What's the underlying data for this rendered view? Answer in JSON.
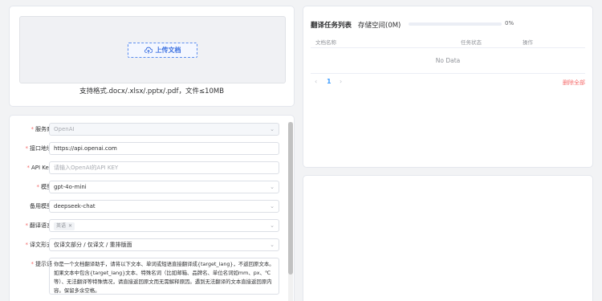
{
  "upload": {
    "button_label": "上传文档",
    "formats_hint": "支持格式.docx/.xlsx/.pptx/.pdf，文件≤10MB"
  },
  "settings": {
    "service": {
      "label": "服务商",
      "required": "*",
      "value": "OpenAI"
    },
    "endpoint": {
      "label": "接口地址",
      "required": "*",
      "value": "https://api.openai.com"
    },
    "api_key": {
      "label": "API Key",
      "required": "*",
      "placeholder": "请输入OpenAI的API KEY"
    },
    "model": {
      "label": "模型",
      "required": "*",
      "value": "gpt-4o-mini"
    },
    "backup_model": {
      "label": "备用模型",
      "value": "deepseek-chat"
    },
    "target_language": {
      "label": "翻译语言",
      "required": "*",
      "tag": "英语"
    },
    "translation_form": {
      "label": "译文形式",
      "required": "*",
      "value": "仅译文部分 / 仅译文 / 重排版面"
    },
    "prompt": {
      "label": "提示语",
      "required": "*",
      "value": "你是一个文档翻译助手，请将以下文本、单词或短语直接翻译成{target_lang}，不返回原文本。如果文本中包含{target_lang}文本、特殊名词（比如邮箱、品牌名、单位名词如mm、px、℃等）、无法翻译等特殊情况，请直接返回原文而无需解释原因。遇到无法翻译的文本直接返回原内容。保留多余空格。"
    }
  },
  "tasks": {
    "title": "翻译任务列表",
    "storage_label": "存储空间(0M)",
    "storage_percent": 0,
    "storage_percent_label": "0%",
    "columns": [
      "文档名称",
      "任务状态",
      "操作"
    ],
    "empty_text": "No Data",
    "pager": {
      "prev": "‹",
      "current": "1",
      "next": "›"
    },
    "delete_all": "删除全部"
  }
}
